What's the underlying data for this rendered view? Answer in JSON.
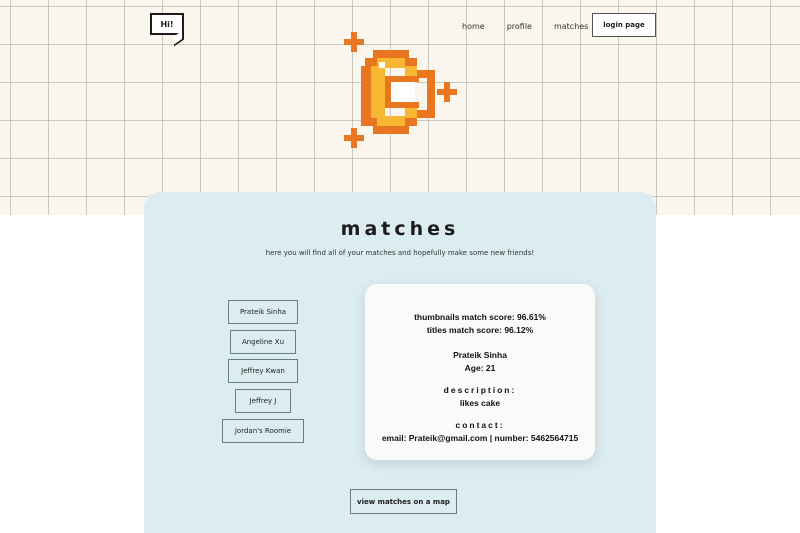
{
  "header": {
    "logo_text": "Hi!",
    "nav": [
      "home",
      "profile",
      "matches"
    ],
    "login_label": "login page"
  },
  "colors": {
    "accent_orange": "#e8771f",
    "accent_yellow": "#f7b733",
    "panel_bg": "#dcedf1"
  },
  "main": {
    "title": "matches",
    "subtitle": "here you will find all of your matches and hopefully make some new friends!",
    "matches": [
      "Prateik Sinha",
      "Angeline Xu",
      "Jeffrey Kwan",
      "Jeffrey J",
      "Jordan's Roomie"
    ],
    "map_button": "view matches on a map"
  },
  "card": {
    "thumb_score": "thumbnails match score: 96.61%",
    "title_score": "titles match score: 96.12%",
    "name": "Prateik Sinha",
    "age": "Age: 21",
    "description_label": "description:",
    "description": "likes cake",
    "contact_label": "contact:",
    "contact": "email: Prateik@gmail.com | number: 5462564715"
  }
}
